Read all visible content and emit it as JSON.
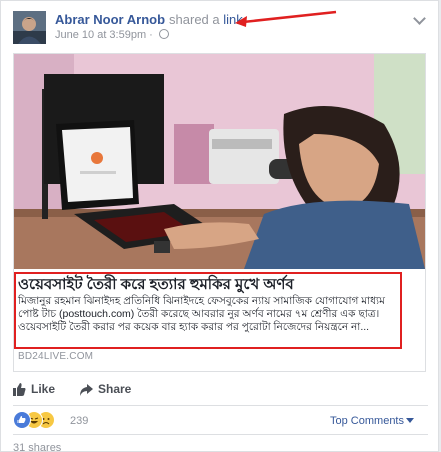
{
  "post": {
    "author": "Abrar Noor Arnob",
    "verb": "shared a",
    "link_word": "link.",
    "timestamp": "June 10 at 3:59pm",
    "audience_icon": "globe-icon"
  },
  "shared_link": {
    "headline": "ওয়েবসাইট তৈরী করে হত্যার হুমকির মুখে অর্ণব",
    "description": "মিজানুর রহমান ঝিনাইদহ প্রতিনিধি ঝিনাইদহে ফেসবুকের ন্যায় সামাজিক যোগাযোগ মাধ্যম পোষ্ট টাচ (posttouch.com) তৈরী করেছে আবরার নুর অর্ণব নামের ৭ম শ্রেণীর এক ছাত্র। ওয়েবসাইটি তৈরী করার পর কয়েক বার হ্যাক করার পর পুরোটা নিজেদের নিয়ন্ত্রনে না...",
    "domain": "BD24LIVE.COM"
  },
  "actions": {
    "like": "Like",
    "share": "Share"
  },
  "reactions": {
    "count": "239",
    "emoji": [
      "like",
      "haha",
      "sad"
    ],
    "sort_label": "Top Comments",
    "more_comments": "31 shares"
  },
  "colors": {
    "link_blue": "#365899",
    "annotation_red": "#e02020",
    "muted": "#90949c"
  }
}
